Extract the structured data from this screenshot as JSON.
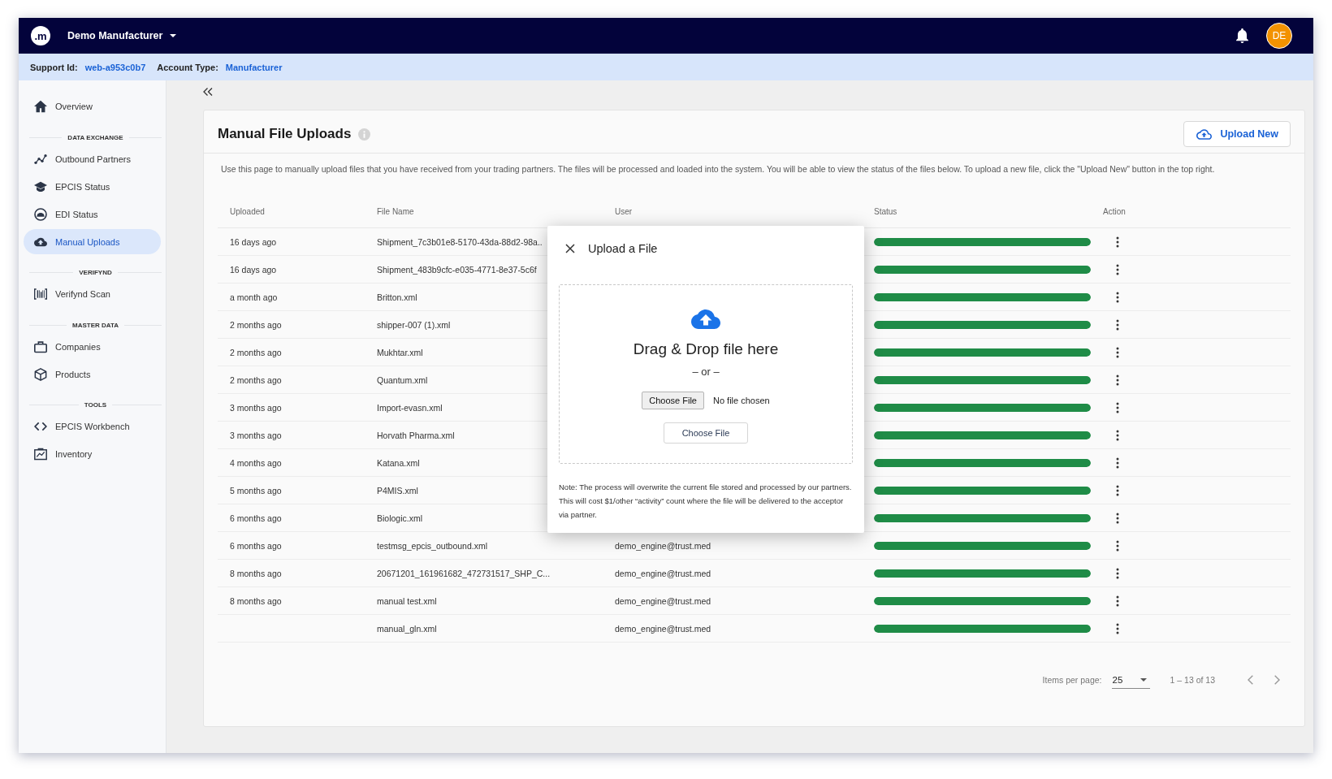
{
  "top_bar": {
    "logo_text": ".m",
    "organization": "Demo Manufacturer",
    "avatar_initials": "DE"
  },
  "info_bar": {
    "support_id_label": "Support Id:",
    "support_id": "web-a953c0b7",
    "account_type_label": "Account Type:",
    "account_type": "Manufacturer"
  },
  "sidebar": {
    "groups": [
      {
        "items": [
          {
            "label": "Overview",
            "selected": false
          }
        ]
      },
      {
        "heading": "DATA EXCHANGE",
        "items": [
          {
            "label": "Outbound Partners",
            "selected": false
          },
          {
            "label": "EPCIS Status",
            "selected": false
          },
          {
            "label": "EDI Status",
            "selected": false
          },
          {
            "label": "Manual Uploads",
            "selected": true
          }
        ]
      },
      {
        "heading": "VERIFYND",
        "items": [
          {
            "label": "Verifynd Scan",
            "selected": false
          }
        ]
      },
      {
        "heading": "MASTER DATA",
        "items": [
          {
            "label": "Companies",
            "selected": false
          },
          {
            "label": "Products",
            "selected": false
          }
        ]
      },
      {
        "heading": "TOOLS",
        "items": [
          {
            "label": "EPCIS Workbench",
            "selected": false
          },
          {
            "label": "Inventory",
            "selected": false
          }
        ]
      }
    ]
  },
  "page": {
    "title": "Manual File Uploads",
    "upload_button": "Upload New",
    "description": "Use this page to manually upload files that you have received from your trading partners. The files will be processed and loaded into the system. You will be able to view the status of the files below. To upload a new file, click the \"Upload New\" button in the top right."
  },
  "table": {
    "columns": [
      "Uploaded",
      "File Name",
      "User",
      "Status",
      "Action"
    ],
    "rows": [
      {
        "uploaded": "16 days ago",
        "file_name": "Shipment_7c3b01e8-5170-43da-88d2-98a..",
        "status": {
          "level": 1
        }
      },
      {
        "uploaded": "16 days ago",
        "file_name": "Shipment_483b9cfc-e035-4771-8e37-5c6f",
        "status": {
          "level": 1
        }
      },
      {
        "uploaded": "a month ago",
        "file_name": "Britton.xml",
        "status": {
          "level": 1
        }
      },
      {
        "uploaded": "2 months ago",
        "file_name": "shipper-007 (1).xml",
        "status": {
          "level": 1
        }
      },
      {
        "uploaded": "2 months ago",
        "file_name": "Mukhtar.xml",
        "status": {
          "level": 1
        }
      },
      {
        "uploaded": "2 months ago",
        "file_name": "Quantum.xml",
        "status": {
          "level": 1
        }
      },
      {
        "uploaded": "3 months ago",
        "file_name": "Import-evasn.xml",
        "status": {
          "level": 1
        }
      },
      {
        "uploaded": "3 months ago",
        "file_name": "Horvath Pharma.xml",
        "status": {
          "level": 1
        }
      },
      {
        "uploaded": "4 months ago",
        "file_name": "Katana.xml",
        "status": {
          "level": 1
        }
      },
      {
        "uploaded": "5 months ago",
        "file_name": "P4MIS.xml",
        "status": {
          "level": 1
        }
      },
      {
        "uploaded": "6 months ago",
        "file_name": "Biologic.xml",
        "status": {
          "level": 1
        }
      },
      {
        "uploaded": "6 months ago",
        "file_name": "testmsg_epcis_outbound.xml",
        "user": "demo_engine@trust.med",
        "status": {
          "level": 1
        }
      },
      {
        "uploaded": "8 months ago",
        "file_name": "20671201_161961682_472731517_SHP_C...",
        "user": "demo_engine@trust.med",
        "status": {
          "level": 1
        }
      },
      {
        "uploaded": "8 months ago",
        "file_name": "manual test.xml",
        "user": "demo_engine@trust.med",
        "status": {
          "level": 1
        }
      },
      {
        "file_name": "manual_gln.xml",
        "user": "demo_engine@trust.med",
        "status": {
          "level": 1
        }
      }
    ]
  },
  "pagination": {
    "items_per_page_label": "Items per page:",
    "items_per_page": "25",
    "range": "1 – 13 of 13"
  },
  "modal": {
    "title": "Upload a File",
    "drop_text": "Drag & Drop file here",
    "separator": "– or –",
    "file_input_button": "Choose File",
    "file_input_status": "No file chosen",
    "choose_button": "Choose File",
    "note": "Note: The process will overwrite the current file stored and processed by our partners. This will cost $1/other “activity” count where the file will be delivered to the acceptor via partner."
  }
}
